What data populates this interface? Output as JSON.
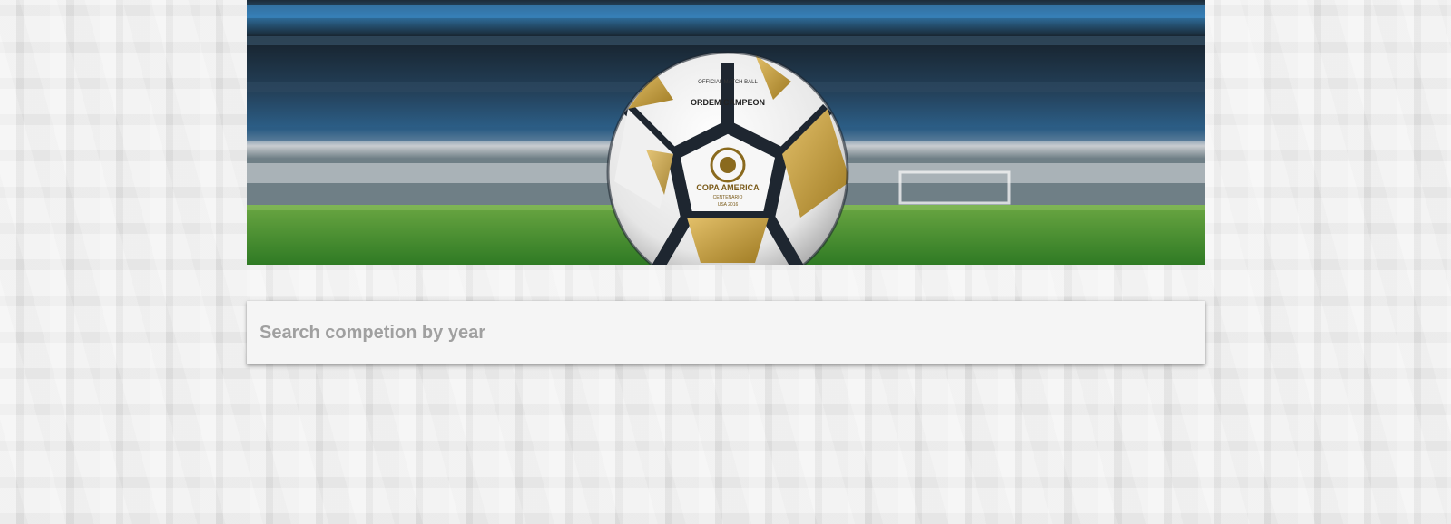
{
  "hero": {
    "ball_brand_text": "ORDEM CAMPEON",
    "ball_top_text": "OFFICIAL MATCH BALL",
    "ball_logo_title": "COPA AMERICA",
    "ball_logo_subtitle": "CENTENARIO",
    "ball_logo_year": "USA 2016",
    "colors": {
      "stadium_blue": "#2a6a9e",
      "grass_green": "#3f8a2a",
      "ball_gold": "#c9a23a",
      "ball_dark": "#1e2630"
    }
  },
  "search": {
    "placeholder": "Search competion by year",
    "value": ""
  },
  "colors": {
    "page_bg": "#ececec",
    "search_bg": "#f5f5f5",
    "placeholder": "#a0a0a0"
  }
}
